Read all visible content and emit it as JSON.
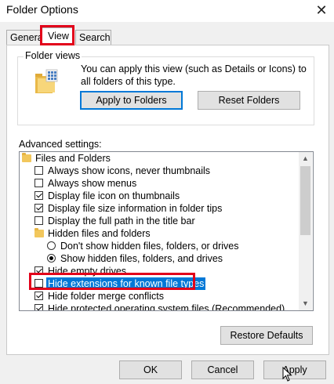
{
  "window": {
    "title": "Folder Options"
  },
  "tabs": [
    {
      "label": "General"
    },
    {
      "label": "View"
    },
    {
      "label": "Search"
    }
  ],
  "folder_views": {
    "title": "Folder views",
    "description": "You can apply this view (such as Details or Icons) to all folders of this type.",
    "apply_button": "Apply to Folders",
    "reset_button": "Reset Folders"
  },
  "advanced": {
    "label": "Advanced settings:",
    "items": [
      {
        "type": "folder",
        "label": "Files and Folders"
      },
      {
        "type": "checkbox",
        "checked": false,
        "label": "Always show icons, never thumbnails"
      },
      {
        "type": "checkbox",
        "checked": false,
        "label": "Always show menus"
      },
      {
        "type": "checkbox",
        "checked": true,
        "label": "Display file icon on thumbnails"
      },
      {
        "type": "checkbox",
        "checked": true,
        "label": "Display file size information in folder tips"
      },
      {
        "type": "checkbox",
        "checked": false,
        "label": "Display the full path in the title bar"
      },
      {
        "type": "folder",
        "label": "Hidden files and folders"
      },
      {
        "type": "radio",
        "checked": false,
        "label": "Don't show hidden files, folders, or drives"
      },
      {
        "type": "radio",
        "checked": true,
        "label": "Show hidden files, folders, and drives"
      },
      {
        "type": "checkbox",
        "checked": true,
        "label": "Hide empty drives"
      },
      {
        "type": "checkbox",
        "checked": false,
        "label": "Hide extensions for known file types",
        "selected": true
      },
      {
        "type": "checkbox",
        "checked": true,
        "label": "Hide folder merge conflicts"
      },
      {
        "type": "checkbox",
        "checked": true,
        "label": "Hide protected operating system files (Recommended)"
      }
    ]
  },
  "restore_button": "Restore Defaults",
  "footer": {
    "ok": "OK",
    "cancel": "Cancel",
    "apply": "Apply"
  },
  "colors": {
    "highlight": "#e2001a",
    "selection": "#0078d7",
    "folder": "#f2c75c"
  }
}
